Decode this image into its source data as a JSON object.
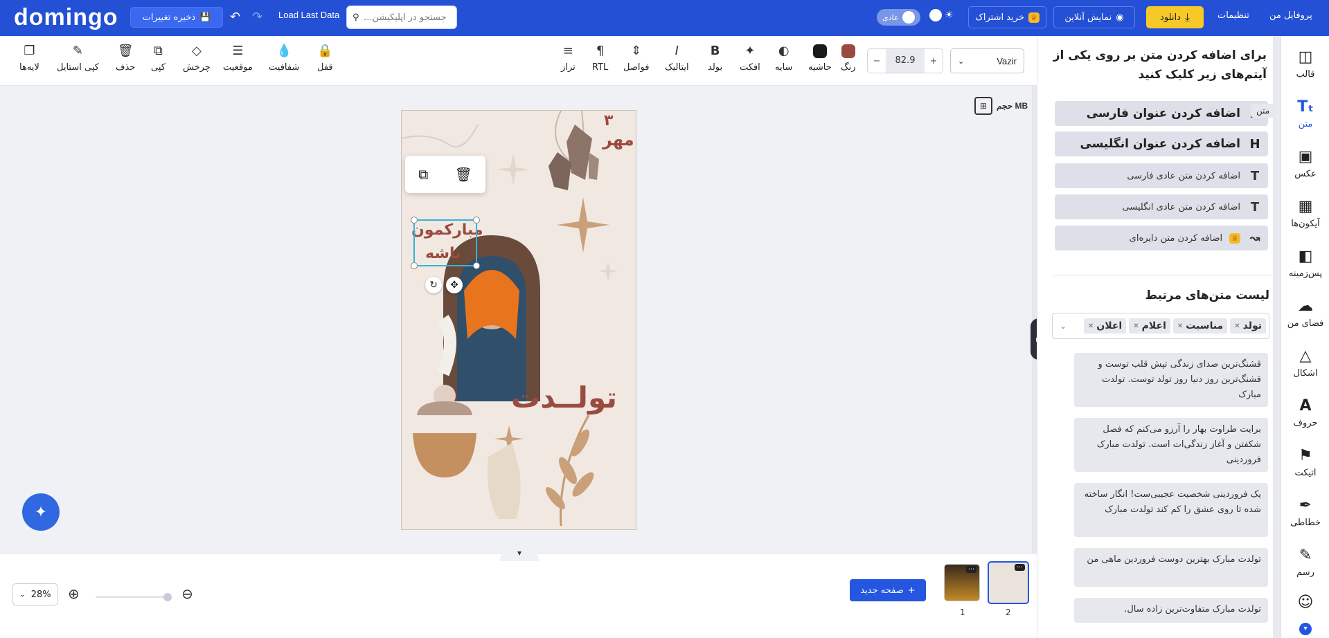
{
  "topbar": {
    "logo": "domingo",
    "save_label": "ذخیره تغییرات",
    "load_last": "Load Last Data",
    "search_placeholder": "جستجو در اپلیکیشن...",
    "mode_label": "عادی",
    "subscribe_label": "خرید اشتراک",
    "online_label": "نمایش آنلاین",
    "download_label": "دانلود",
    "settings_label": "تنظیمات",
    "profile_label": "پروفایل من",
    "accent": "#2450d6",
    "download_color": "#f7c928"
  },
  "toolbar": {
    "left_tools": [
      {
        "label": "لایه‌ها",
        "icon": "layers-icon"
      },
      {
        "label": "کپی استایل",
        "icon": "paint-brush-icon"
      },
      {
        "label": "حذف",
        "icon": "trash-icon"
      },
      {
        "label": "کپی",
        "icon": "copy-icon"
      },
      {
        "label": "چرخش",
        "icon": "rotate-icon"
      },
      {
        "label": "موقعیت",
        "icon": "stack-icon"
      },
      {
        "label": "شفافیت",
        "icon": "drop-icon"
      },
      {
        "label": "قفل",
        "icon": "lock-icon"
      }
    ],
    "text_tools": [
      {
        "label": "تراز",
        "icon": "align-icon"
      },
      {
        "label": "RTL",
        "icon": "paragraph-icon"
      },
      {
        "label": "فواصل",
        "icon": "spacing-icon"
      },
      {
        "label": "ایتالیک",
        "icon": "italic-icon"
      },
      {
        "label": "بولد",
        "icon": "bold-icon"
      },
      {
        "label": "افکت",
        "icon": "effect-icon"
      },
      {
        "label": "سایه",
        "icon": "shadow-icon"
      },
      {
        "label": "حاشیه",
        "icon": "stroke-icon"
      },
      {
        "label": "رنگ",
        "icon": "color-icon"
      }
    ],
    "stroke_color": "#1a1a1a",
    "text_color": "#9a4b3f",
    "font_size": "82.9",
    "font_name": "Vazir"
  },
  "canvas": {
    "file_size_label": "حجم MB",
    "selected_text_line1": "مبارکمون",
    "selected_text_line2": "باشه",
    "date_number": "۳",
    "date_month": "مهر",
    "title_text": "تولــدت"
  },
  "bottom": {
    "zoom": "28%",
    "new_page_label": "صفحه جدید",
    "pages": [
      "1",
      "2"
    ]
  },
  "panel": {
    "title": "برای اضافه کردن متن بر روی یکی از آیتم‌های زیر کلیک کنید",
    "add_buttons": [
      {
        "label": "اضافه کردن عنوان فارسی",
        "icon": "H"
      },
      {
        "label": "اضافه کردن عنوان انگلیسی",
        "icon": "H"
      },
      {
        "label": "اضافه کردن متن عادی فارسی",
        "icon": "T"
      },
      {
        "label": "اضافه کردن متن عادی انگلیسی",
        "icon": "T"
      },
      {
        "label": "اضافه کردن متن دایره‌ای",
        "icon": "curve"
      }
    ],
    "list_title": "لیست متن‌های مرتبط",
    "tags": [
      "تولد",
      "مناسبت",
      "اعلام",
      "اعلان"
    ],
    "texts": [
      "قشنگ‌ترین صدای زندگی تپش قلب توست و قشنگ‌ترین روز دنیا روز تولد توست. تولدت مبارک",
      "برایت طراوت بهار را آرزو می‌کنم که فصل شکفتن و آغاز زندگی‌ات است. تولدت مبارک فروردینی",
      "یک فروردینی شخصیت عجیبی‌ست! انگار ساخته شده تا روی عشق را کم کند تولدت مبارک",
      "تولدت مبارک بهترین دوست فروردین ماهی من",
      "تولدت مبارک متفاوت‌ترین زاده سال."
    ]
  },
  "rail": {
    "tooltip": "متن",
    "items": [
      {
        "label": "قالب",
        "icon": "template-icon"
      },
      {
        "label": "متن",
        "icon": "text-icon"
      },
      {
        "label": "عکس",
        "icon": "image-icon"
      },
      {
        "label": "آیکون‌ها",
        "icon": "grid-icon"
      },
      {
        "label": "پس‌زمینه",
        "icon": "background-icon"
      },
      {
        "label": "فضای من",
        "icon": "cloud-upload-icon"
      },
      {
        "label": "اشکال",
        "icon": "shapes-icon"
      },
      {
        "label": "حروف",
        "icon": "letter-icon"
      },
      {
        "label": "اتیکت",
        "icon": "tag-icon"
      },
      {
        "label": "خطاطی",
        "icon": "feather-icon"
      },
      {
        "label": "رسم",
        "icon": "pencil-icon"
      }
    ]
  }
}
